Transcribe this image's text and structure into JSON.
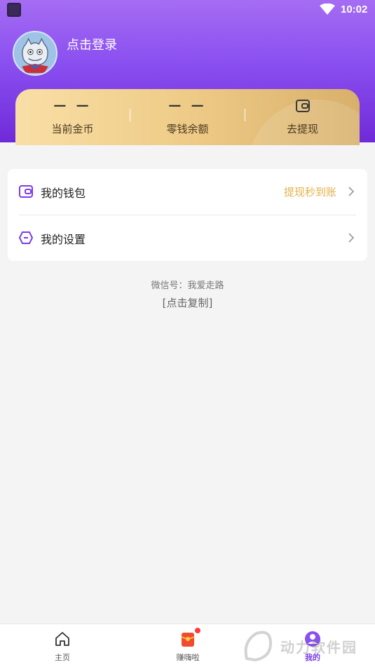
{
  "status_bar": {
    "time": "10:02"
  },
  "profile": {
    "login_text": "点击登录"
  },
  "stats": [
    {
      "value": "— —",
      "label": "当前金币"
    },
    {
      "value": "— —",
      "label": "零钱余额"
    },
    {
      "label": "去提现",
      "icon": "wallet-icon"
    }
  ],
  "menu": {
    "wallet": {
      "label": "我的钱包",
      "extra": "提现秒到账"
    },
    "settings": {
      "label": "我的设置"
    }
  },
  "wechat": {
    "line": "微信号：我爱走路",
    "copy": "[点击复制]"
  },
  "bottom_nav": [
    {
      "label": "主页",
      "icon": "home-icon"
    },
    {
      "label": "赚嗨啦",
      "icon": "red-envelope-icon"
    },
    {
      "label": "我的",
      "icon": "profile-icon",
      "active": true
    }
  ],
  "watermark": {
    "text": "动力软件园"
  },
  "colors": {
    "accent": "#7b3de6",
    "gold": "#e3b24a",
    "header_top": "#a56cf3",
    "header_bottom": "#6f2ad8"
  }
}
